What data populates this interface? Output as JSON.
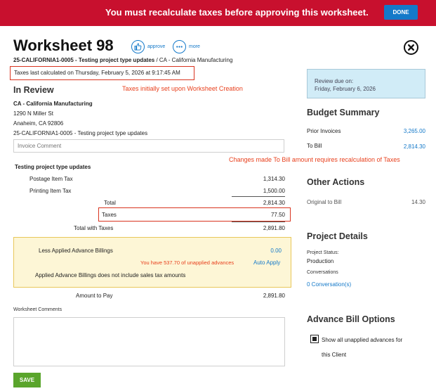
{
  "banner": {
    "message": "You must recalculate taxes before approving this worksheet.",
    "done_label": "DONE"
  },
  "header": {
    "title": "Worksheet 98",
    "approve_label": "approve",
    "more_label": "more",
    "job_number": "25-CALIFORNIA1-0005 - Testing project type updates",
    "client_suffix": " / CA - California Manufacturing",
    "taxes_calculated": "Taxes last calculated on Thursday, February 5, 2026 at 9:17:45 AM"
  },
  "main": {
    "status": "In Review",
    "annotation_taxes_initial": "Taxes initially set upon Worksheet Creation",
    "annotation_changes": "Changes made To Bill amount requires recalculation of Taxes",
    "client_name": "CA - California Manufacturing",
    "address_line1": "1290 N Miller St",
    "address_line2": "Anaheim, CA 92806",
    "job_line": "25-CALIFORNIA1-0005 - Testing project type updates",
    "invoice_comment_placeholder": "Invoice Comment",
    "section_title": "Testing project type updates",
    "line_items": [
      {
        "label": "Postage Item Tax",
        "amount": "1,314.30"
      },
      {
        "label": "Printing Item Tax",
        "amount": "1,500.00"
      }
    ],
    "total_label": "Total",
    "total_value": "2,814.30",
    "taxes_label": "Taxes",
    "taxes_value": "77.50",
    "total_with_taxes_label": "Total with Taxes",
    "total_with_taxes_value": "2,891.80",
    "advance": {
      "label": "Less Applied Advance Billings",
      "value": "0.00",
      "unapplied_note": "You have 537.70 of unapplied advances",
      "auto_apply": "Auto Apply",
      "disclaimer": "Applied Advance Billings does not include sales tax amounts"
    },
    "amount_to_pay_label": "Amount to Pay",
    "amount_to_pay_value": "2,891.80",
    "worksheet_comments_label": "Worksheet Comments",
    "save_label": "SAVE"
  },
  "sidebar": {
    "review_due_label": "Review due on:",
    "review_due_date": "Friday, February 6, 2026",
    "budget_title": "Budget Summary",
    "prior_invoices_label": "Prior Invoices",
    "prior_invoices_value": "3,265.00",
    "to_bill_label": "To Bill",
    "to_bill_value": "2,814.30",
    "other_actions_title": "Other Actions",
    "original_to_bill_label": "Original to Bill",
    "original_to_bill_value": "14.30",
    "project_details_title": "Project Details",
    "project_status_label": "Project Status:",
    "project_status_value": "Production",
    "conversations_label": "Conversations",
    "conversations_link": "0 Conversation(s)",
    "advance_bill_title": "Advance Bill Options",
    "show_unapplied_line1": "Show all unapplied advances for",
    "show_unapplied_line2": "this Client",
    "show_unapplied_checked": true
  },
  "colors": {
    "banner": "#c8102e",
    "accent_blue": "#1479c9",
    "annotation_red": "#e8401d",
    "save_green": "#5aa52c",
    "review_box": "#d1ecf7",
    "advance_box": "#fdf6d6"
  }
}
